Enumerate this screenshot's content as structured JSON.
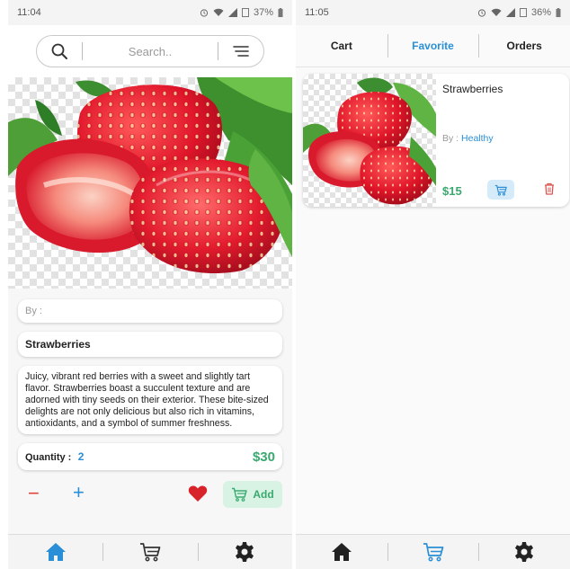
{
  "left": {
    "status": {
      "time": "11:04",
      "battery": "37%"
    },
    "search": {
      "placeholder": "Search.."
    },
    "product": {
      "by_label": "By :",
      "by_value": "",
      "name": "Strawberries",
      "description": "Juicy, vibrant red berries with a sweet and slightly tart flavor. Strawberries boast a succulent texture and are adorned with tiny seeds on their exterior. These bite-sized delights are not only delicious but also rich in vitamins, antioxidants, and a symbol of summer freshness.",
      "quantity_label": "Quantity :",
      "quantity": "2",
      "price": "$30"
    },
    "actions": {
      "minus": "−",
      "plus": "+",
      "add_label": "Add"
    },
    "nav": {
      "active": "home-icon",
      "items": [
        "home-icon",
        "cart-icon",
        "settings-icon"
      ]
    }
  },
  "right": {
    "status": {
      "time": "11:05",
      "battery": "36%"
    },
    "tabs": [
      {
        "label": "Cart"
      },
      {
        "label": "Favorite",
        "active": true
      },
      {
        "label": "Orders"
      }
    ],
    "favorite_item": {
      "name": "Strawberries",
      "by_label": "By :",
      "by_value": "Healthy",
      "price": "$15"
    },
    "nav": {
      "active": "cart-icon",
      "items": [
        "home-icon",
        "cart-icon",
        "settings-icon"
      ]
    }
  },
  "colors": {
    "accent_blue": "#2a8fd6",
    "price_green": "#3aa96f",
    "minus_red": "#e0413a",
    "heart_red": "#d9232b",
    "add_bg": "#d8f3e4"
  }
}
